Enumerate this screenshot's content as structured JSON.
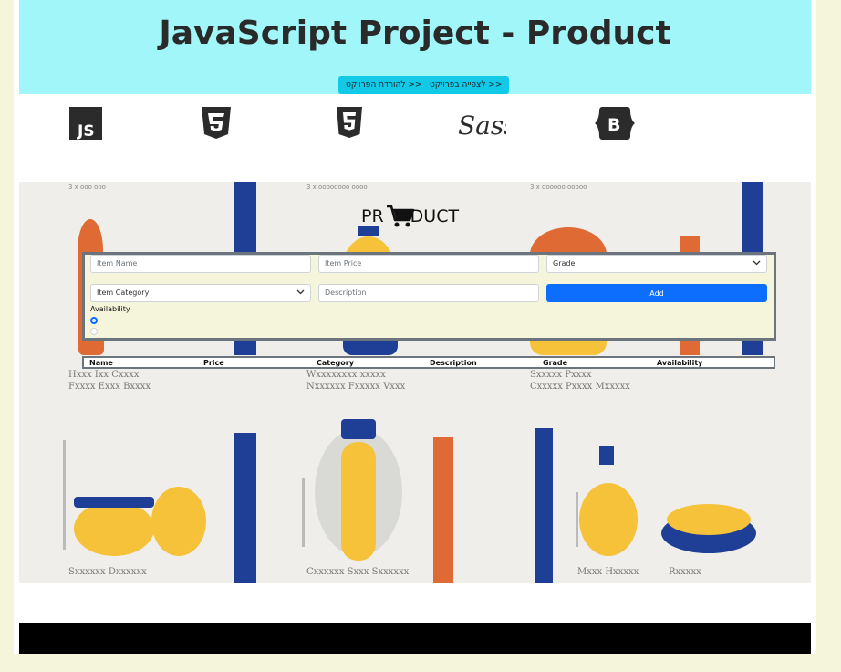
{
  "header": {
    "title": "JavaScript Project - Product",
    "download_button": "<< להורדת הפרויקט",
    "view_button": "<< לצפייה בפרויקט"
  },
  "tech_logos": [
    "js-icon",
    "css3-icon",
    "html5-icon",
    "sass-icon",
    "bootstrap-icon"
  ],
  "product_heading": {
    "left": "PR",
    "right": "DUCT",
    "icon": "cart-icon"
  },
  "form": {
    "item_name_placeholder": "Item Name",
    "item_price_placeholder": "Item Price",
    "grade_selected": "Grade",
    "item_category_selected": "Item Category",
    "description_placeholder": "Description",
    "add_button": "Add",
    "availability_label": "Availability"
  },
  "table": {
    "columns": [
      "Name",
      "Price",
      "Category",
      "Description",
      "Grade",
      "Availability"
    ]
  },
  "colors": {
    "header_bg": "#a0f6f9",
    "page_bg": "#f5f5dc",
    "button_cyan": "#13c9e8",
    "primary_blue": "#0d6efd",
    "footer_bg": "#000000"
  }
}
